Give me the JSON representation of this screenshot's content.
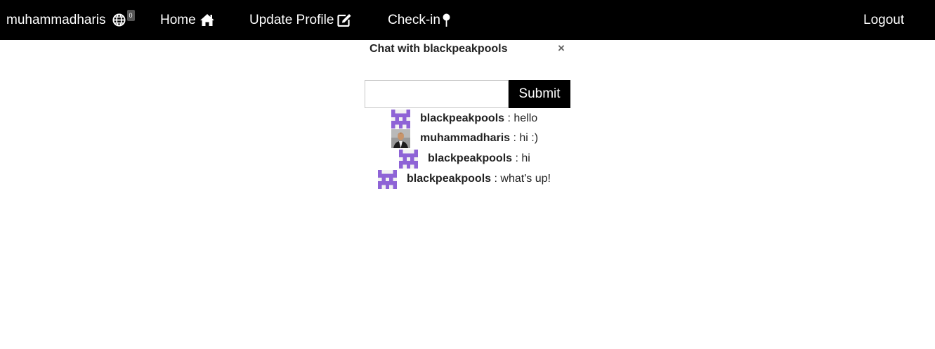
{
  "navbar": {
    "username": "muhammadharis",
    "notification_count": "0",
    "home_label": "Home",
    "update_profile_label": "Update Profile",
    "checkin_label": "Check-in",
    "logout_label": "Logout"
  },
  "chat": {
    "title": "Chat with blackpeakpools",
    "close_symbol": "×",
    "input_value": "",
    "submit_label": "Submit",
    "messages": [
      {
        "user": "blackpeakpools",
        "separator": " : ",
        "text": "hello",
        "avatar": "identicon-avatar"
      },
      {
        "user": "muhammadharis",
        "separator": " : ",
        "text": "hi :)",
        "avatar": "photo-avatar"
      },
      {
        "user": "blackpeakpools",
        "separator": " : ",
        "text": "hi",
        "avatar": "identicon-avatar"
      },
      {
        "user": "blackpeakpools",
        "separator": " : ",
        "text": "what's up!",
        "avatar": "identicon-avatar"
      }
    ]
  },
  "colors": {
    "navbar_bg": "#000000",
    "navbar_text": "#ffffff",
    "submit_bg": "#000000",
    "identicon": "#8e63d6",
    "badge_bg": "#555555"
  },
  "icons": {
    "globe": "globe-icon",
    "home": "home-icon",
    "edit": "edit-icon",
    "pin": "map-pin-icon"
  }
}
